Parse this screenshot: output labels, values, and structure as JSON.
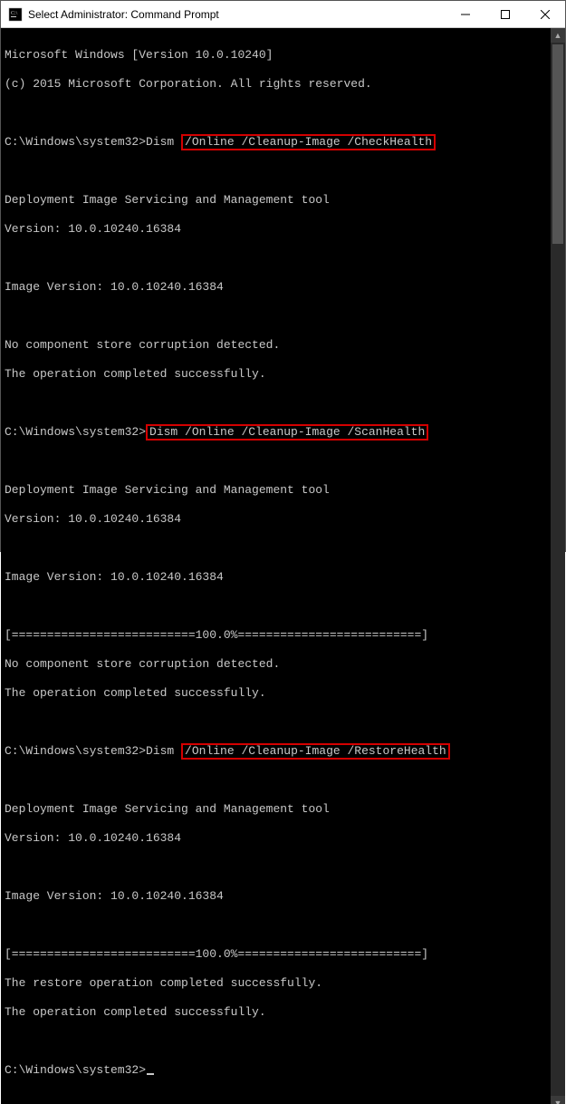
{
  "window": {
    "title": "Select Administrator: Command Prompt"
  },
  "content": {
    "l1": "Microsoft Windows [Version 10.0.10240]",
    "l2": "(c) 2015 Microsoft Corporation. All rights reserved.",
    "l3": "",
    "p1_pre": "C:\\Windows\\system32>Dism ",
    "p1_hl": "/Online /Cleanup-Image /CheckHealth",
    "l5": "",
    "l6": "Deployment Image Servicing and Management tool",
    "l7": "Version: 10.0.10240.16384",
    "l8": "",
    "l9": "Image Version: 10.0.10240.16384",
    "l10": "",
    "l11": "No component store corruption detected.",
    "l12": "The operation completed successfully.",
    "l13": "",
    "p2_pre": "C:\\Windows\\system32>",
    "p2_hl": "Dism /Online /Cleanup-Image /ScanHealth",
    "l15": "",
    "l16": "Deployment Image Servicing and Management tool",
    "l17": "Version: 10.0.10240.16384",
    "l18": "",
    "l19": "Image Version: 10.0.10240.16384",
    "l20": "",
    "l21": "[==========================100.0%==========================]",
    "l22": "No component store corruption detected.",
    "l23": "The operation completed successfully.",
    "l24": "",
    "p3_pre": "C:\\Windows\\system32>Dism ",
    "p3_hl": "/Online /Cleanup-Image /RestoreHealth",
    "l26": "",
    "l27": "Deployment Image Servicing and Management tool",
    "l28": "Version: 10.0.10240.16384",
    "l29": "",
    "l30": "Image Version: 10.0.10240.16384",
    "l31": "",
    "l32": "[==========================100.0%==========================]",
    "l33": "The restore operation completed successfully.",
    "l34": "The operation completed successfully.",
    "l35": "",
    "p4": "C:\\Windows\\system32>"
  }
}
